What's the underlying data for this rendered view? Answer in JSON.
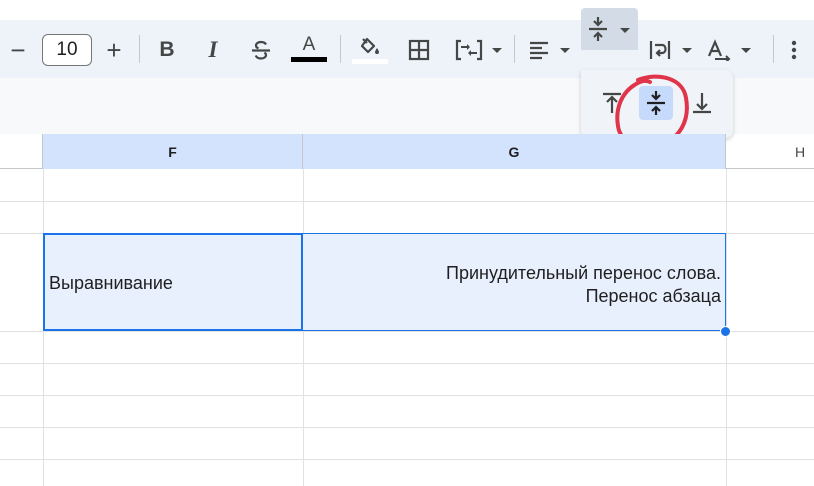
{
  "toolbar": {
    "font_size_value": "10",
    "minus_label": "−",
    "plus_label": "+",
    "bold_label": "B",
    "italic_label": "I",
    "text_color_letter": "A",
    "text_color_bar": "#000000",
    "fill_color_bar": "#ffffff",
    "icons": [
      "decrease-font-size-icon",
      "increase-font-size-icon",
      "bold-icon",
      "italic-icon",
      "strikethrough-icon",
      "text-color-icon",
      "fill-color-icon",
      "borders-icon",
      "merge-cells-icon",
      "horizontal-align-icon",
      "vertical-align-icon",
      "text-wrapping-icon",
      "text-rotation-icon",
      "more-options-icon"
    ]
  },
  "valign_popup": {
    "options": [
      "align-top-icon",
      "align-middle-icon",
      "align-bottom-icon"
    ],
    "selected": "align-middle-icon"
  },
  "grid": {
    "columns": [
      "F",
      "G",
      "H"
    ],
    "selected_columns": [
      "F",
      "G"
    ]
  },
  "cells": {
    "f_text": "Выравнивание",
    "g_line1": "Принудительный перенос слова.",
    "g_line2": "Перенос абзаца"
  },
  "colors": {
    "selection_border": "#1a73e8",
    "selection_fill": "#e8f0fe",
    "annotation": "#e0344a"
  }
}
